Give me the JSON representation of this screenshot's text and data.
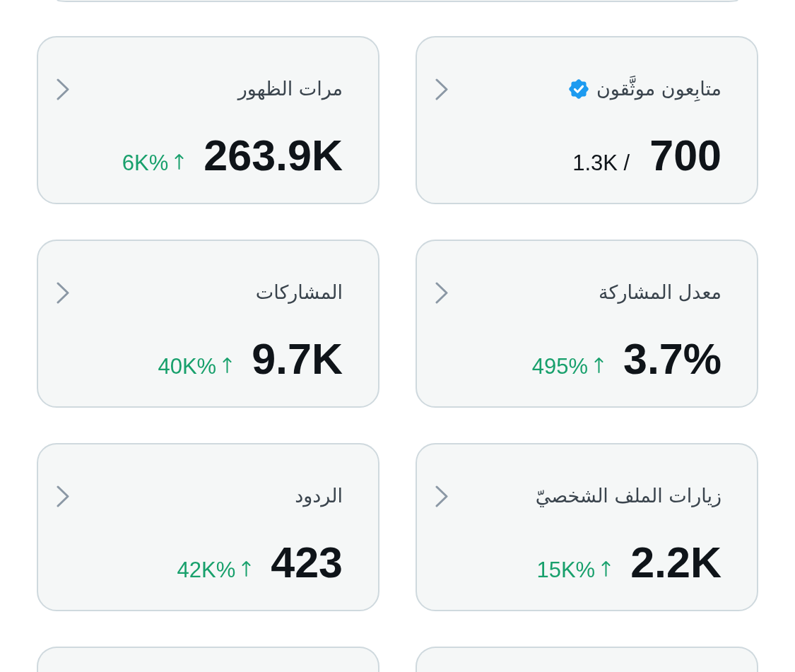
{
  "cards": [
    {
      "kind": "ratio",
      "title": "متابِعون موثَّقون",
      "verified": true,
      "value": "700",
      "total": "1.3K /"
    },
    {
      "kind": "change",
      "title": "مرات الظهور",
      "verified": false,
      "value": "263.9K",
      "change": "6K%",
      "rising": true
    },
    {
      "kind": "change",
      "title": "معدل المشاركة",
      "verified": false,
      "value": "3.7%",
      "change": "495%",
      "rising": true
    },
    {
      "kind": "change",
      "title": "المشاركات",
      "verified": false,
      "value": "9.7K",
      "change": "40K%",
      "rising": true
    },
    {
      "kind": "change",
      "title": "زيارات الملف الشخصيّ",
      "verified": false,
      "value": "2.2K",
      "change": "15K%",
      "rising": true
    },
    {
      "kind": "change",
      "title": "الردود",
      "verified": false,
      "value": "423",
      "change": "42K%",
      "rising": true
    }
  ]
}
